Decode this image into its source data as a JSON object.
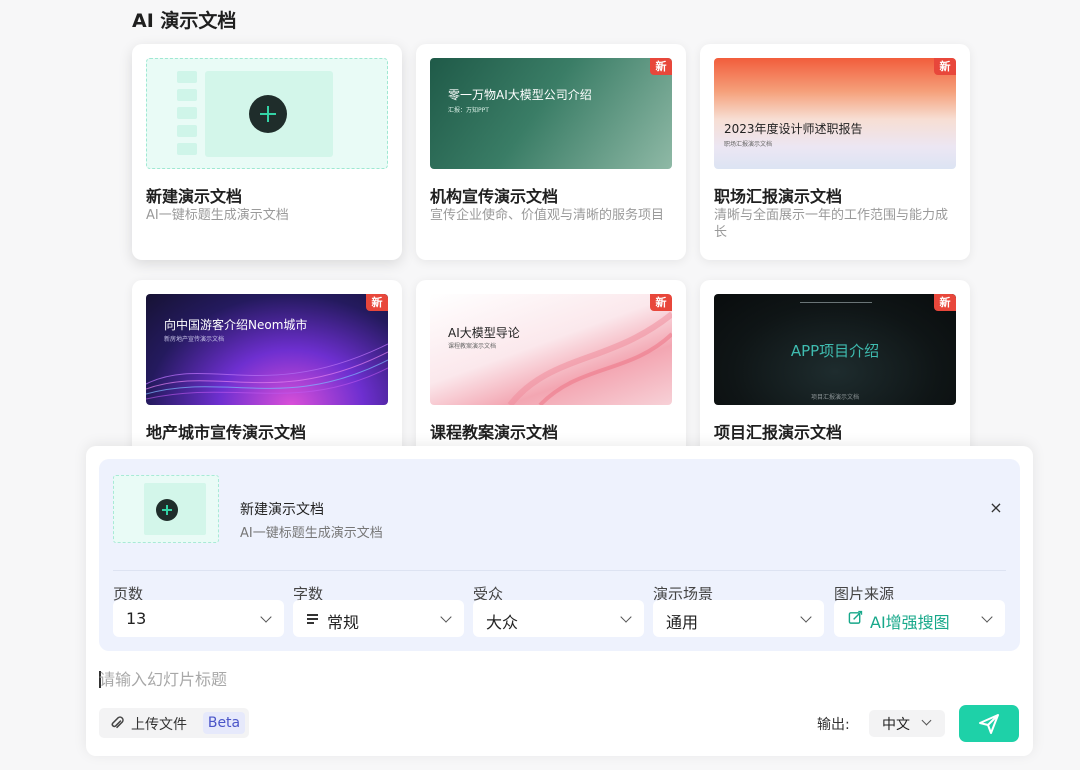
{
  "section": {
    "title": "AI 演示文档"
  },
  "cards": [
    {
      "title": "新建演示文档",
      "desc": "AI一键标题生成演示文档"
    },
    {
      "title": "机构宣传演示文档",
      "desc": "宣传企业使命、价值观与清晰的服务项目",
      "badge": "新",
      "thumb_title": "零一万物AI大模型公司介绍",
      "thumb_sub": "汇报：万知PPT"
    },
    {
      "title": "职场汇报演示文档",
      "desc": "清晰与全面展示一年的工作范围与能力成长",
      "badge": "新",
      "thumb_title": "2023年度设计师述职报告",
      "thumb_sub": "职场汇报演示文档"
    },
    {
      "title": "地产城市宣传演示文档",
      "badge": "新",
      "thumb_title": "向中国游客介绍Neom城市",
      "thumb_sub": "新房地产宣传演示文档"
    },
    {
      "title": "课程教案演示文档",
      "badge": "新",
      "thumb_title": "AI大模型导论",
      "thumb_sub": "课程教案演示文档"
    },
    {
      "title": "项目汇报演示文档",
      "badge": "新",
      "thumb_title": "APP项目介绍",
      "thumb_sub": "项目汇报演示文档"
    }
  ],
  "composer": {
    "selected_title": "新建演示文档",
    "selected_desc": "AI一键标题生成演示文档",
    "close_label": "×",
    "fields": {
      "pages": {
        "label": "页数",
        "value": "13"
      },
      "words": {
        "label": "字数",
        "value": "常规"
      },
      "audience": {
        "label": "受众",
        "value": "大众"
      },
      "scene": {
        "label": "演示场景",
        "value": "通用"
      },
      "image_source": {
        "label": "图片来源",
        "value": "AI增强搜图"
      }
    },
    "input_placeholder": "请输入幻灯片标题",
    "upload_label": "上传文件",
    "beta_label": "Beta",
    "output_label": "输出:",
    "output_lang": "中文"
  },
  "colors": {
    "accent": "#1ed1a8",
    "badge": "#e8473b",
    "beta": "#4a55c8"
  }
}
